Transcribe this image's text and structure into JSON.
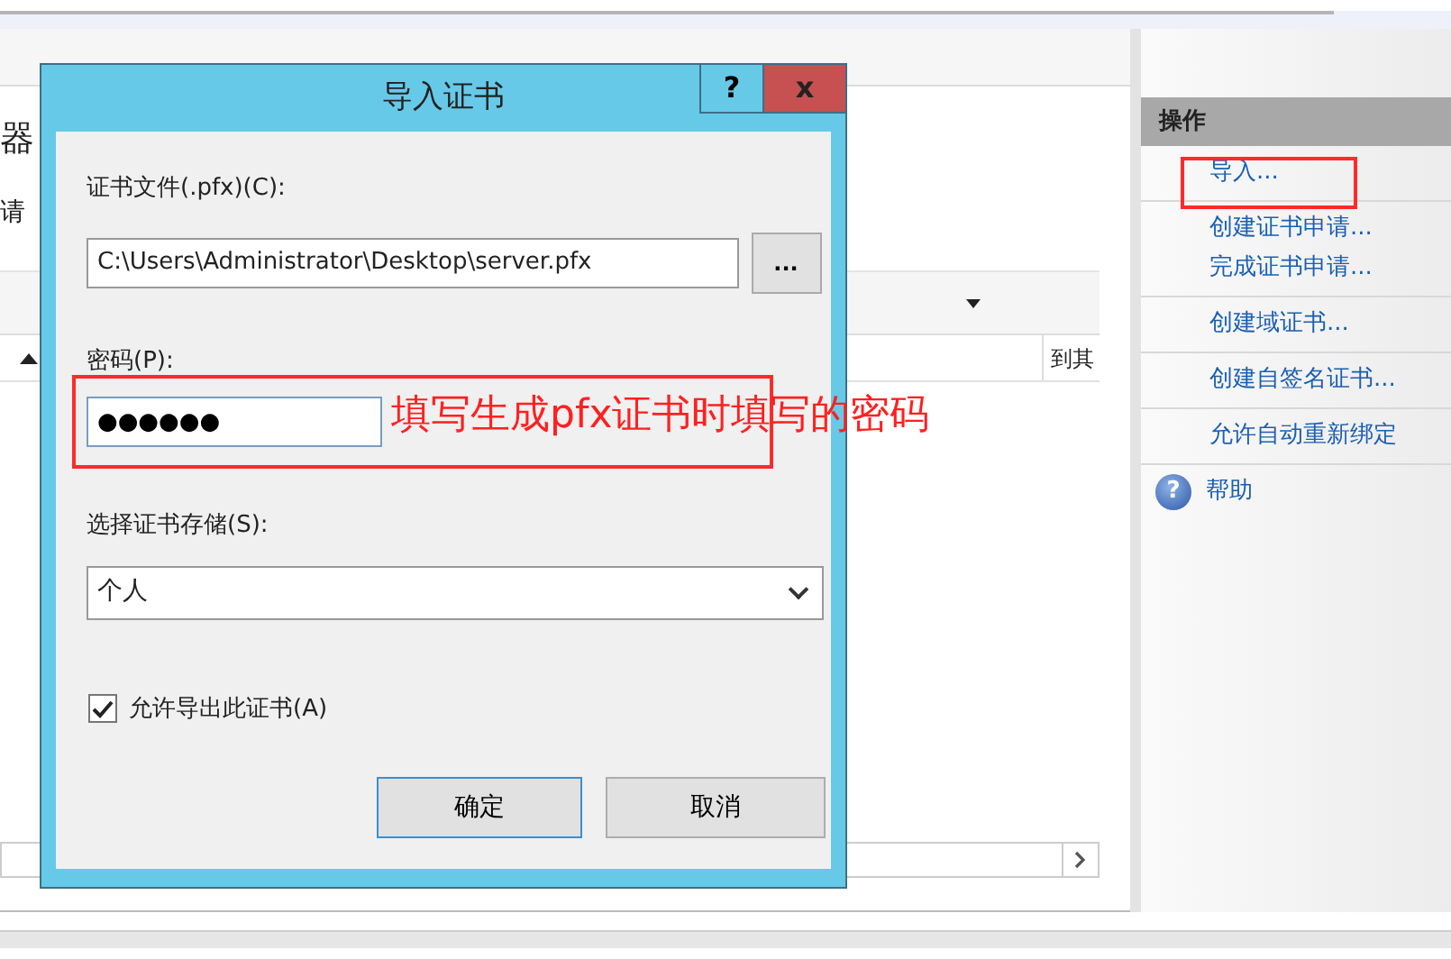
{
  "background": {
    "left_fragments": [
      "器",
      "请"
    ],
    "columns": [
      "到其"
    ]
  },
  "actions_pane": {
    "title": "操作",
    "groups": [
      [
        {
          "label": "导入...",
          "kind": "link"
        }
      ],
      [
        {
          "label": "创建证书申请...",
          "kind": "link"
        },
        {
          "label": "完成证书申请...",
          "kind": "link"
        }
      ],
      [
        {
          "label": "创建域证书...",
          "kind": "link"
        }
      ],
      [
        {
          "label": "创建自签名证书...",
          "kind": "link"
        }
      ],
      [
        {
          "label": "允许自动重新绑定",
          "kind": "link"
        }
      ],
      [
        {
          "label": "帮助",
          "kind": "help",
          "icon_glyph": "?"
        }
      ]
    ]
  },
  "dialog": {
    "title": "导入证书",
    "help_button": "?",
    "close_button": "x",
    "file_label": "证书文件(.pfx)(C):",
    "file_value": "C:\\Users\\Administrator\\Desktop\\server.pfx",
    "browse_button": "...",
    "password_label": "密码(P):",
    "password_value": "●●●●●●",
    "store_label": "选择证书存储(S):",
    "store_value": "个人",
    "export_checkbox": {
      "label": "允许导出此证书(A)",
      "checked": true
    },
    "buttons": [
      {
        "label": "确定",
        "default": true
      },
      {
        "label": "取消",
        "default": false
      }
    ]
  },
  "annotation": {
    "note": "填写生成pfx证书时填写的密码"
  }
}
